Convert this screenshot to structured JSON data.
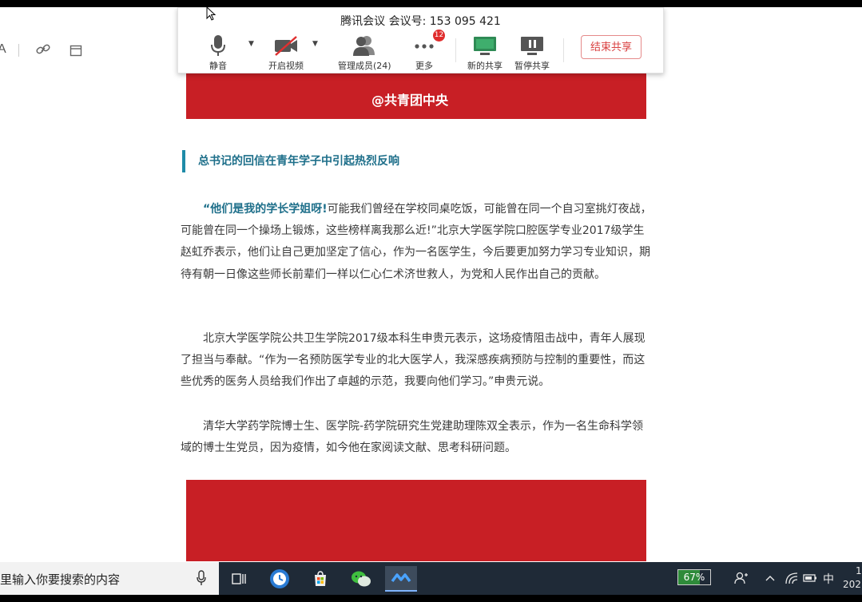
{
  "meeting": {
    "title": "腾讯会议  会议号: 153 095 421",
    "buttons": {
      "mute": "静音",
      "video": "开启视频",
      "members": "管理成员(24)",
      "more": "更多",
      "new_share": "新的共享",
      "pause_share": "暂停共享",
      "end_share": "结束共享"
    },
    "more_badge": "12"
  },
  "toolbar": {
    "font_glyph": "A"
  },
  "article": {
    "banner_logo": "@共青团中央",
    "section_title": "总书记的回信在青年学子中引起热烈反响",
    "p1_highlight": "“他们是我的学长学姐呀!",
    "p1_rest": "可能我们曾经在学校同桌吃饭，可能曾在同一个自习室挑灯夜战，可能曾在同一个操场上锻炼，这些榜样离我那么近!”北京大学医学院口腔医学专业2017级学生赵虹乔表示，他们让自己更加坚定了信心，作为一名医学生，今后要更加努力学习专业知识，期待有朝一日像这些师长前辈们一样以仁心仁术济世救人，为党和人民作出自己的贡献。",
    "p2": "北京大学医学院公共卫生学院2017级本科生申贵元表示，这场疫情阻击战中，青年人展现了担当与奉献。“作为一名预防医学专业的北大医学人，我深感疾病预防与控制的重要性，而这些优秀的医务人员给我们作出了卓越的示范，我要向他们学习。”申贵元说。",
    "p3": "清华大学药学院博士生、医学院-药学院研究生党建助理陈双全表示，作为一名生命科学领域的博士生党员，因为疫情，如今他在家阅读文献、思考科研问题。"
  },
  "taskbar": {
    "search_text": "里输入你要搜索的内容",
    "battery": "67%",
    "battery_level": 0.67,
    "ime": "中",
    "clock_line1": "1",
    "clock_line2": "202"
  },
  "colors": {
    "banner": "#c81f25",
    "accent": "#1e6f8a",
    "end_share": "#d94040",
    "taskbar": "#1f2a37"
  }
}
